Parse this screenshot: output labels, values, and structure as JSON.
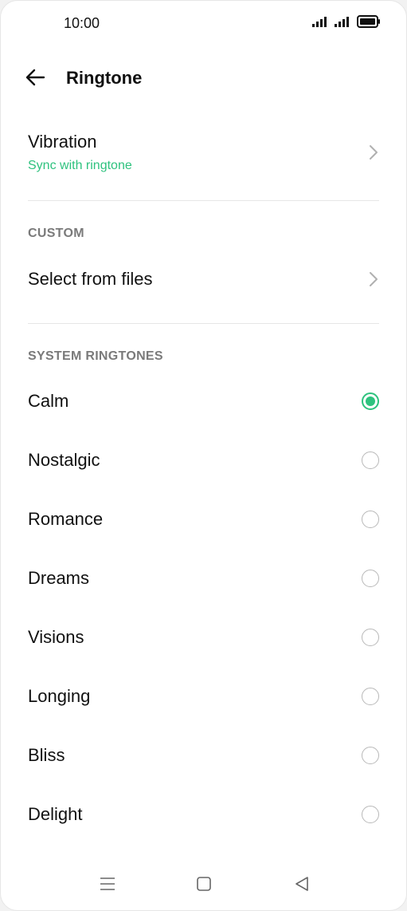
{
  "status_bar": {
    "time": "10:00"
  },
  "appbar": {
    "title": "Ringtone"
  },
  "vibration": {
    "label": "Vibration",
    "sub": "Sync with ringtone"
  },
  "custom": {
    "header": "CUSTOM",
    "select_label": "Select from files"
  },
  "system": {
    "header": "SYSTEM RINGTONES",
    "items": [
      {
        "label": "Calm",
        "selected": true
      },
      {
        "label": "Nostalgic",
        "selected": false
      },
      {
        "label": "Romance",
        "selected": false
      },
      {
        "label": "Dreams",
        "selected": false
      },
      {
        "label": "Visions",
        "selected": false
      },
      {
        "label": "Longing",
        "selected": false
      },
      {
        "label": "Bliss",
        "selected": false
      },
      {
        "label": "Delight",
        "selected": false
      }
    ]
  },
  "colors": {
    "accent": "#2ec27e"
  }
}
